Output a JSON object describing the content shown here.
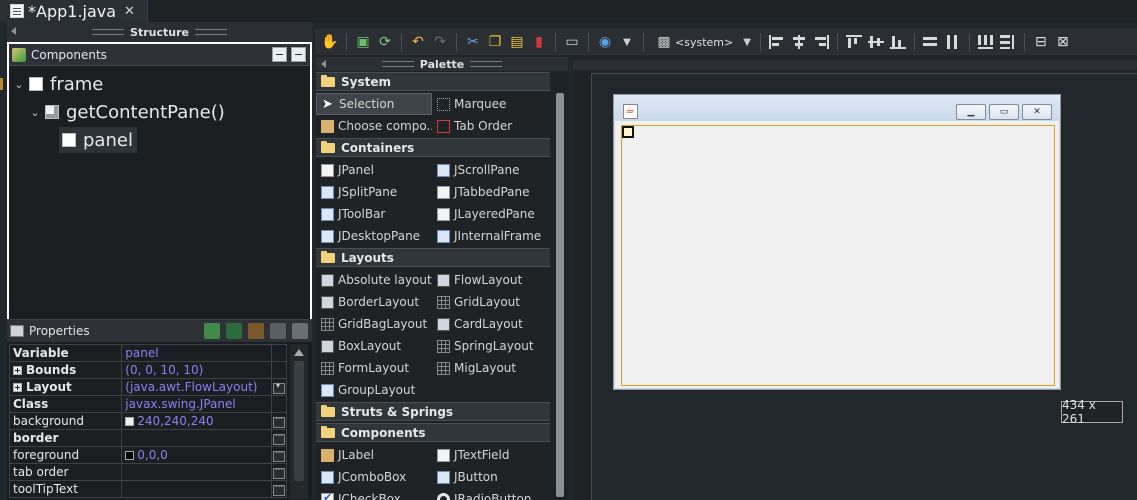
{
  "tab": {
    "title": "*App1.java",
    "close": "✕"
  },
  "structure": {
    "header": "Structure",
    "components_header": "Components",
    "tree": [
      {
        "label": "frame"
      },
      {
        "label": "getContentPane()"
      },
      {
        "label": "panel"
      }
    ]
  },
  "properties": {
    "header": "Properties",
    "rows": [
      {
        "key": "Variable",
        "value": "panel"
      },
      {
        "key": "Bounds",
        "value": "(0, 0, 10, 10)"
      },
      {
        "key": "Layout",
        "value": "(java.awt.FlowLayout)"
      },
      {
        "key": "Class",
        "value": "javax.swing.JPanel"
      },
      {
        "key": "background",
        "value": "240,240,240",
        "swatch": "#f0f0f0"
      },
      {
        "key": "border",
        "value": ""
      },
      {
        "key": "foreground",
        "value": "0,0,0",
        "swatch": "#000000"
      },
      {
        "key": "tab order",
        "value": ""
      },
      {
        "key": "toolTipText",
        "value": ""
      }
    ]
  },
  "toolbar": {
    "system_combo": "<system>"
  },
  "palette": {
    "header": "Palette",
    "categories": {
      "system": "System",
      "containers": "Containers",
      "layouts": "Layouts",
      "struts": "Struts & Springs",
      "components": "Components"
    },
    "system_items": [
      "Selection",
      "Marquee",
      "Choose compo...",
      "Tab Order"
    ],
    "container_items": [
      "JPanel",
      "JScrollPane",
      "JSplitPane",
      "JTabbedPane",
      "JToolBar",
      "JLayeredPane",
      "JDesktopPane",
      "JInternalFrame"
    ],
    "layout_items": [
      "Absolute layout",
      "FlowLayout",
      "BorderLayout",
      "GridLayout",
      "GridBagLayout",
      "CardLayout",
      "BoxLayout",
      "SpringLayout",
      "FormLayout",
      "MigLayout",
      "GroupLayout"
    ],
    "component_items": [
      "JLabel",
      "JTextField",
      "JComboBox",
      "JButton",
      "JCheckBox",
      "JRadioButton"
    ]
  },
  "canvas": {
    "size_label": "434 x 261"
  },
  "colors": {
    "accent": "#d9a320",
    "property_value": "#8f7df0"
  }
}
